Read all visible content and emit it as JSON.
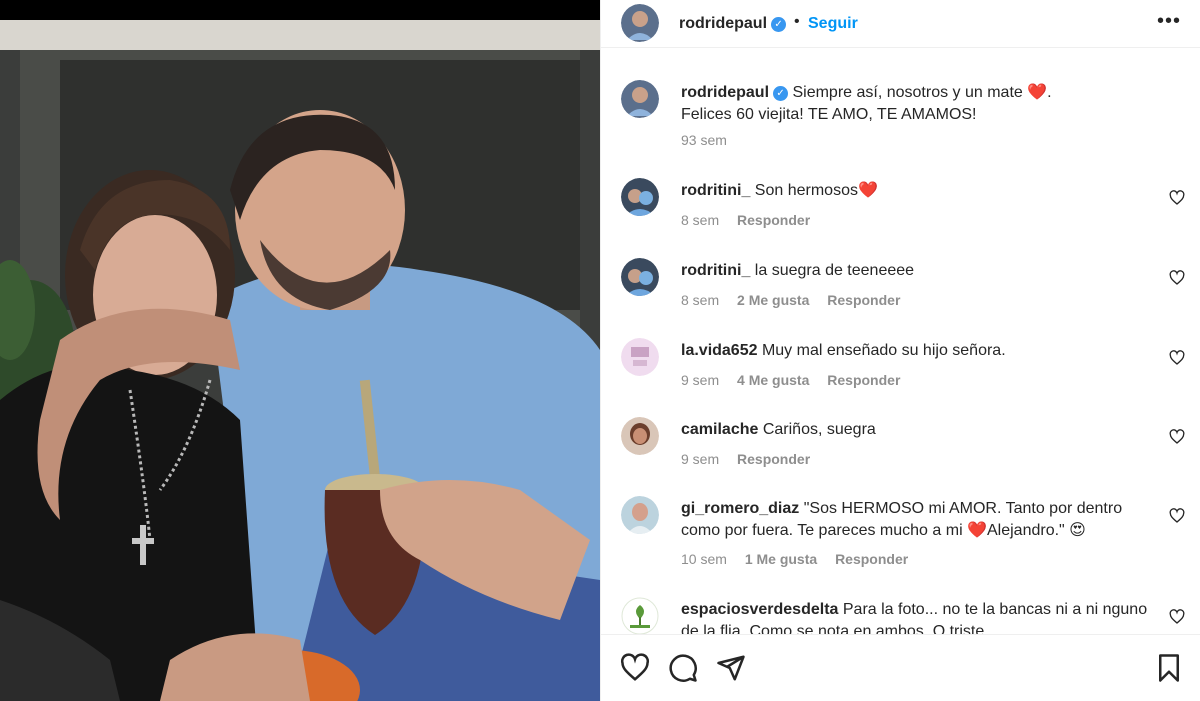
{
  "post": {
    "username": "rodridepaul",
    "verified_icon": "verified-badge-icon",
    "follow_label": "Seguir",
    "separator": "•",
    "more_label": "•••"
  },
  "caption": {
    "username": "rodridepaul",
    "text_line1": "Siempre así, nosotros y un mate",
    "heart": "❤️",
    "text_line1_end": ".",
    "text_line2": "Felices 60 viejita! TE AMO, TE AMAMOS!",
    "time": "93 sem"
  },
  "comments": [
    {
      "username": "rodritini_",
      "text": "Son hermosos❤️",
      "time": "8 sem",
      "likes": "",
      "reply": "Responder"
    },
    {
      "username": "rodritini_",
      "text": "la suegra de teeneeee",
      "time": "8 sem",
      "likes": "2 Me gusta",
      "reply": "Responder"
    },
    {
      "username": "la.vida652",
      "text": "Muy mal enseñado su hijo señora.",
      "time": "9 sem",
      "likes": "4 Me gusta",
      "reply": "Responder"
    },
    {
      "username": "camilache",
      "text": "Cariños, suegra",
      "time": "9 sem",
      "likes": "",
      "reply": "Responder"
    },
    {
      "username": "gi_romero_diaz",
      "text": "\"Sos HERMOSO mi AMOR. Tanto por dentro como por fuera. Te pareces mucho a mi ❤️Alejandro.\" 😍",
      "time": "10 sem",
      "likes": "1 Me gusta",
      "reply": "Responder"
    },
    {
      "username": "espaciosverdesdelta",
      "text": "Para la foto... no te la bancas ni a ni nguno de la flia. Como se nota en ambos. Q triste",
      "time": "",
      "likes": "",
      "reply": ""
    }
  ],
  "icons": {
    "like": "heart-outline-icon",
    "comment": "comment-bubble-icon",
    "share": "paper-plane-icon",
    "save": "bookmark-icon"
  },
  "colors": {
    "accent": "#0095f6",
    "verified": "#3897f0",
    "muted": "#8e8e8e",
    "heart": "#ed4956"
  }
}
